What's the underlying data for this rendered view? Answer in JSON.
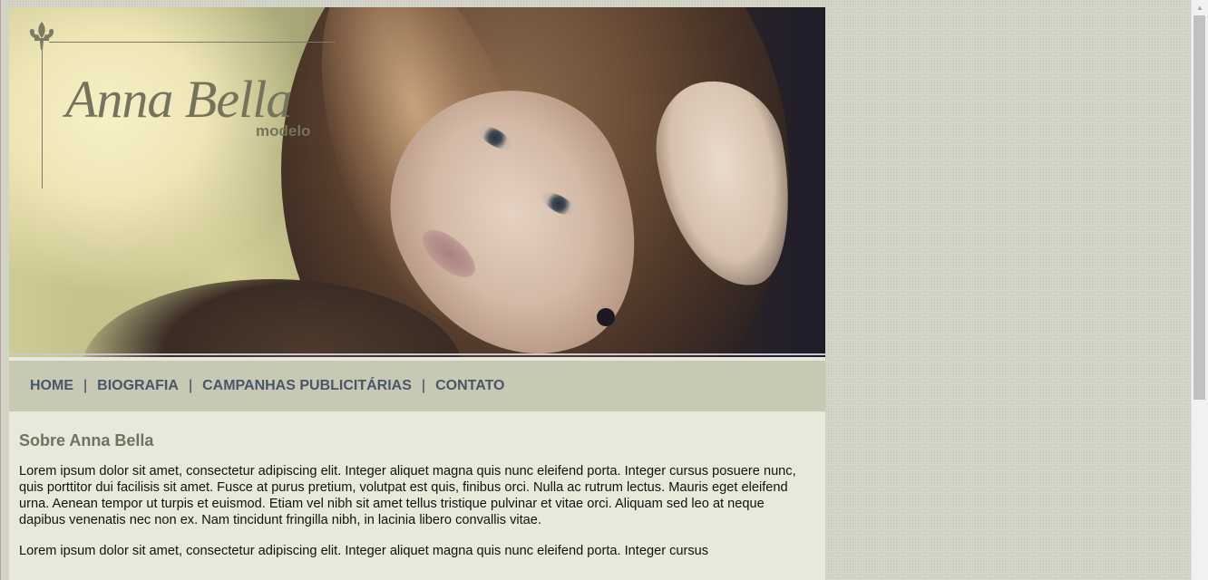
{
  "logo": {
    "name": "Anna Bella",
    "subtitle": "modelo"
  },
  "nav": {
    "items": [
      {
        "label": "HOME"
      },
      {
        "label": "BIOGRAFIA"
      },
      {
        "label": "CAMPANHAS PUBLICITÁRIAS"
      },
      {
        "label": "CONTATO"
      }
    ],
    "separator": "|"
  },
  "content": {
    "heading": "Sobre Anna Bella",
    "paragraphs": [
      "Lorem ipsum dolor sit amet, consectetur adipiscing elit. Integer aliquet magna quis nunc eleifend porta. Integer cursus posuere nunc, quis porttitor dui facilisis sit amet. Fusce at purus pretium, volutpat est quis, finibus orci. Nulla ac rutrum lectus. Mauris eget eleifend urna. Aenean tempor ut turpis et euismod. Etiam vel nibh sit amet tellus tristique pulvinar et vitae orci. Aliquam sed leo at neque dapibus venenatis nec non ex. Nam tincidunt fringilla nibh, in lacinia libero convallis vitae.",
      "Lorem ipsum dolor sit amet, consectetur adipiscing elit. Integer aliquet magna quis nunc eleifend porta. Integer cursus"
    ]
  },
  "colors": {
    "nav_link": "#4b5569",
    "nav_bg": "#c8c9b5",
    "content_bg": "#e8e9da",
    "heading": "#717161",
    "page_bg": "#d5d6c8"
  }
}
